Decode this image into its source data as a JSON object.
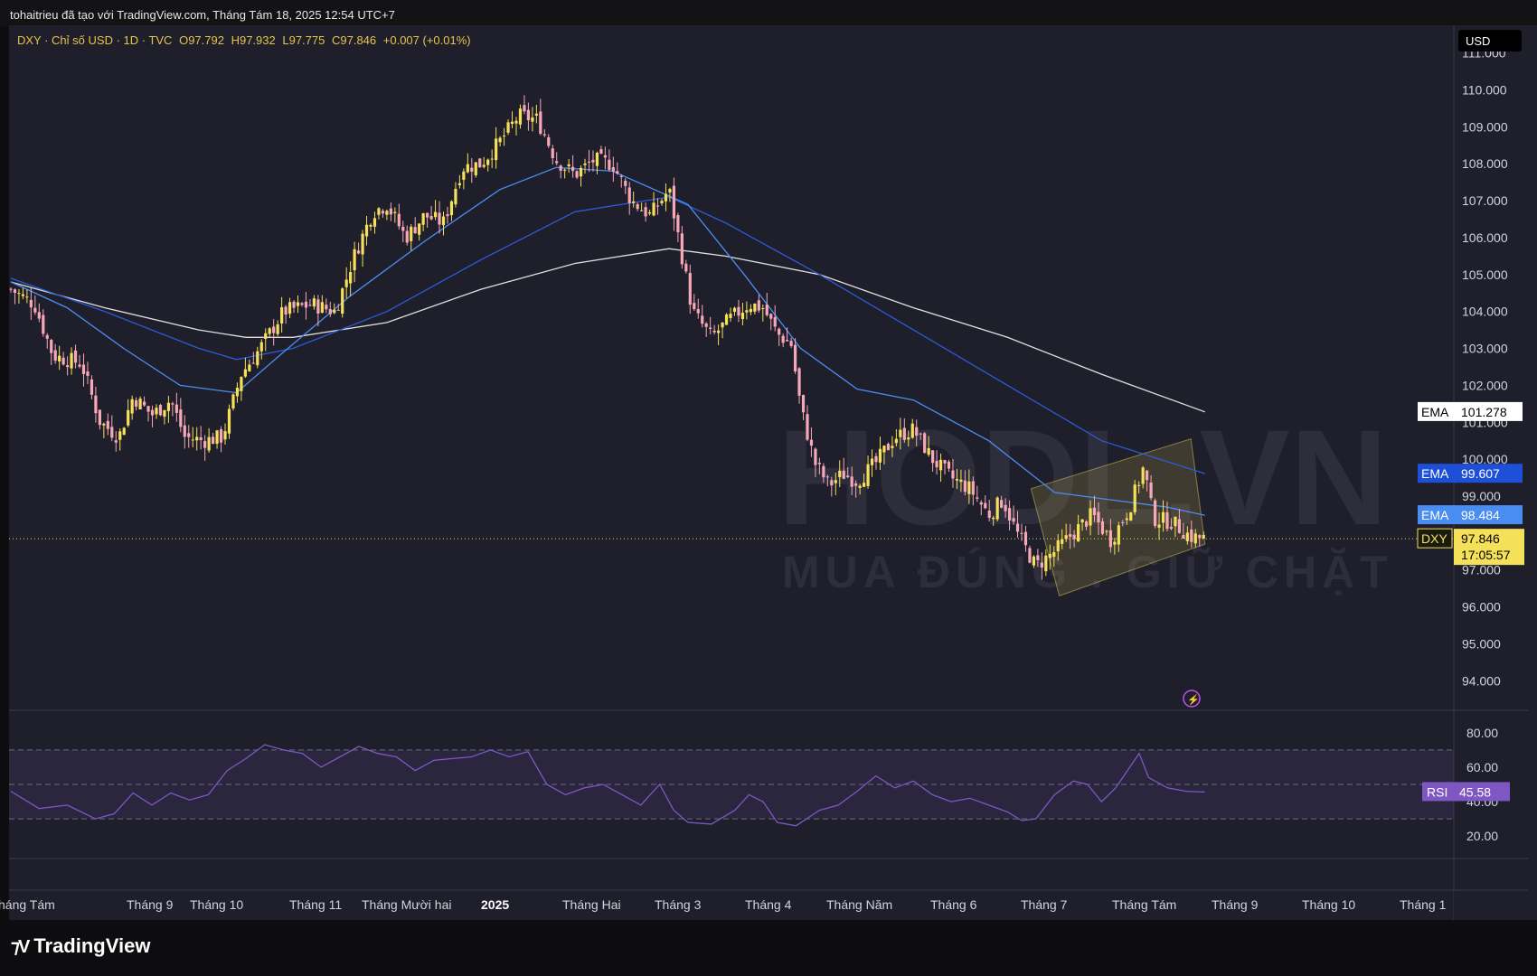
{
  "header": {
    "attribution": "tohaitrieu đã tạo với TradingView.com, Tháng Tám 18, 2025 12:54 UTC+7"
  },
  "symbol_line": {
    "name": "DXY · Chỉ số USD · 1D · TVC",
    "open": "O97.792",
    "high": "H97.932",
    "low": "L97.775",
    "close": "C97.846",
    "change": "+0.007 (+0.01%)"
  },
  "currency_label": "USD",
  "watermark": {
    "brand": "HODL.VN",
    "tagline": "MUA ĐÚNG . GIỮ CHẶT"
  },
  "price_labels": [
    {
      "name": "EMA",
      "value": "101.278",
      "color": "#ffffff"
    },
    {
      "name": "EMA",
      "value": "99.607",
      "color": "#1e4fd8"
    },
    {
      "name": "EMA",
      "value": "98.484",
      "color": "#4a8df0"
    },
    {
      "name": "DXY",
      "value": "97.846",
      "countdown": "17:05:57",
      "color": "#f5e05a"
    }
  ],
  "rsi_label": {
    "name": "RSI",
    "value": "45.58",
    "color": "#7e57c2"
  },
  "footer": {
    "brand": "TradingView"
  },
  "colors": {
    "background": "#1f1f2b",
    "up": "#f5e05a",
    "down": "#f7a8b8",
    "ema_white": "#e0e0e0",
    "ema_dark_blue": "#2b5bd8",
    "ema_light_blue": "#4a8df0",
    "rsi": "#7e57c2"
  },
  "chart_data": [
    {
      "type": "candlestick",
      "symbol": "DXY",
      "timeframe": "1D",
      "y_axis": {
        "ticks": [
          "111.000",
          "110.000",
          "109.000",
          "108.000",
          "107.000",
          "106.000",
          "105.000",
          "104.000",
          "103.000",
          "102.000",
          "101.000",
          "100.000",
          "99.000",
          "97.000",
          "96.000",
          "95.000",
          "94.000"
        ],
        "range": [
          93.2,
          111.7
        ]
      },
      "x_axis": {
        "ticks": [
          "háng Tám",
          "Tháng 9",
          "Tháng 10",
          "Tháng 11",
          "Tháng Mười hai",
          "2025",
          "Tháng Hai",
          "Tháng 3",
          "Tháng 4",
          "Tháng Năm",
          "Tháng 6",
          "Tháng 7",
          "Tháng Tám",
          "Tháng 9",
          "Tháng 10",
          "Tháng 1"
        ]
      },
      "close_path": [
        {
          "x": 0,
          "y": 104.6
        },
        {
          "x": 25,
          "y": 104.2
        },
        {
          "x": 45,
          "y": 102.8
        },
        {
          "x": 75,
          "y": 102.6
        },
        {
          "x": 95,
          "y": 101.0
        },
        {
          "x": 115,
          "y": 100.6
        },
        {
          "x": 130,
          "y": 101.7
        },
        {
          "x": 150,
          "y": 101.2
        },
        {
          "x": 170,
          "y": 101.6
        },
        {
          "x": 185,
          "y": 100.6
        },
        {
          "x": 205,
          "y": 100.5
        },
        {
          "x": 225,
          "y": 100.6
        },
        {
          "x": 245,
          "y": 102.3
        },
        {
          "x": 265,
          "y": 103.0
        },
        {
          "x": 290,
          "y": 104.0
        },
        {
          "x": 320,
          "y": 104.2
        },
        {
          "x": 345,
          "y": 104.0
        },
        {
          "x": 365,
          "y": 105.5
        },
        {
          "x": 385,
          "y": 106.7
        },
        {
          "x": 400,
          "y": 106.9
        },
        {
          "x": 420,
          "y": 106.0
        },
        {
          "x": 440,
          "y": 106.6
        },
        {
          "x": 460,
          "y": 106.4
        },
        {
          "x": 480,
          "y": 107.9
        },
        {
          "x": 500,
          "y": 108.0
        },
        {
          "x": 520,
          "y": 108.6
        },
        {
          "x": 540,
          "y": 109.3
        },
        {
          "x": 560,
          "y": 109.2
        },
        {
          "x": 580,
          "y": 108.1
        },
        {
          "x": 600,
          "y": 107.7
        },
        {
          "x": 620,
          "y": 108.1
        },
        {
          "x": 640,
          "y": 108.0
        },
        {
          "x": 660,
          "y": 107.0
        },
        {
          "x": 680,
          "y": 106.6
        },
        {
          "x": 700,
          "y": 107.3
        },
        {
          "x": 710,
          "y": 106.0
        },
        {
          "x": 725,
          "y": 104.0
        },
        {
          "x": 745,
          "y": 103.3
        },
        {
          "x": 765,
          "y": 103.8
        },
        {
          "x": 785,
          "y": 104.2
        },
        {
          "x": 800,
          "y": 104.1
        },
        {
          "x": 815,
          "y": 103.4
        },
        {
          "x": 830,
          "y": 103.1
        },
        {
          "x": 840,
          "y": 101.4
        },
        {
          "x": 855,
          "y": 99.9
        },
        {
          "x": 870,
          "y": 99.3
        },
        {
          "x": 885,
          "y": 99.6
        },
        {
          "x": 900,
          "y": 99.4
        },
        {
          "x": 920,
          "y": 99.9
        },
        {
          "x": 940,
          "y": 100.6
        },
        {
          "x": 960,
          "y": 100.8
        },
        {
          "x": 980,
          "y": 100.0
        },
        {
          "x": 1000,
          "y": 99.5
        },
        {
          "x": 1020,
          "y": 99.2
        },
        {
          "x": 1040,
          "y": 98.5
        },
        {
          "x": 1055,
          "y": 98.9
        },
        {
          "x": 1070,
          "y": 98.0
        },
        {
          "x": 1090,
          "y": 97.1
        },
        {
          "x": 1110,
          "y": 97.5
        },
        {
          "x": 1130,
          "y": 98.0
        },
        {
          "x": 1150,
          "y": 98.5
        },
        {
          "x": 1170,
          "y": 97.8
        },
        {
          "x": 1190,
          "y": 98.7
        },
        {
          "x": 1205,
          "y": 99.8
        },
        {
          "x": 1215,
          "y": 98.4
        },
        {
          "x": 1235,
          "y": 98.3
        },
        {
          "x": 1255,
          "y": 97.9
        },
        {
          "x": 1270,
          "y": 97.85
        }
      ],
      "series": [
        {
          "name": "EMA",
          "last": 101.278,
          "values": [
            {
              "x": 0,
              "y": 104.8
            },
            {
              "x": 100,
              "y": 104.1
            },
            {
              "x": 200,
              "y": 103.5
            },
            {
              "x": 250,
              "y": 103.3
            },
            {
              "x": 300,
              "y": 103.3
            },
            {
              "x": 400,
              "y": 103.7
            },
            {
              "x": 500,
              "y": 104.6
            },
            {
              "x": 600,
              "y": 105.3
            },
            {
              "x": 700,
              "y": 105.7
            },
            {
              "x": 760,
              "y": 105.5
            },
            {
              "x": 860,
              "y": 105.0
            },
            {
              "x": 960,
              "y": 104.1
            },
            {
              "x": 1060,
              "y": 103.3
            },
            {
              "x": 1160,
              "y": 102.3
            },
            {
              "x": 1270,
              "y": 101.28
            }
          ]
        },
        {
          "name": "EMA",
          "last": 99.607,
          "values": [
            {
              "x": 0,
              "y": 104.9
            },
            {
              "x": 100,
              "y": 104.0
            },
            {
              "x": 200,
              "y": 103.0
            },
            {
              "x": 240,
              "y": 102.7
            },
            {
              "x": 300,
              "y": 103.0
            },
            {
              "x": 400,
              "y": 104.0
            },
            {
              "x": 500,
              "y": 105.4
            },
            {
              "x": 600,
              "y": 106.7
            },
            {
              "x": 700,
              "y": 107.1
            },
            {
              "x": 760,
              "y": 106.4
            },
            {
              "x": 860,
              "y": 105.0
            },
            {
              "x": 960,
              "y": 103.5
            },
            {
              "x": 1060,
              "y": 102.0
            },
            {
              "x": 1160,
              "y": 100.5
            },
            {
              "x": 1270,
              "y": 99.61
            }
          ]
        },
        {
          "name": "EMA",
          "last": 98.484,
          "values": [
            {
              "x": 0,
              "y": 104.8
            },
            {
              "x": 60,
              "y": 104.1
            },
            {
              "x": 120,
              "y": 103.0
            },
            {
              "x": 180,
              "y": 102.0
            },
            {
              "x": 240,
              "y": 101.8
            },
            {
              "x": 290,
              "y": 102.9
            },
            {
              "x": 360,
              "y": 104.4
            },
            {
              "x": 440,
              "y": 105.9
            },
            {
              "x": 520,
              "y": 107.3
            },
            {
              "x": 580,
              "y": 107.9
            },
            {
              "x": 640,
              "y": 107.8
            },
            {
              "x": 720,
              "y": 106.9
            },
            {
              "x": 780,
              "y": 105.0
            },
            {
              "x": 840,
              "y": 103.0
            },
            {
              "x": 900,
              "y": 101.9
            },
            {
              "x": 960,
              "y": 101.6
            },
            {
              "x": 1040,
              "y": 100.5
            },
            {
              "x": 1110,
              "y": 99.1
            },
            {
              "x": 1170,
              "y": 98.9
            },
            {
              "x": 1230,
              "y": 98.7
            },
            {
              "x": 1270,
              "y": 98.48
            }
          ]
        }
      ],
      "last_price": 97.846,
      "annotation": {
        "type": "channel",
        "shaded": true
      }
    },
    {
      "type": "line",
      "name": "RSI",
      "y_axis": {
        "ticks": [
          "80.00",
          "60.00",
          "40.00",
          "20.00"
        ],
        "range": [
          7,
          93
        ]
      },
      "bands": [
        70,
        50,
        30
      ],
      "last": 45.58,
      "values": [
        {
          "x": 0,
          "y": 46
        },
        {
          "x": 30,
          "y": 36
        },
        {
          "x": 60,
          "y": 38
        },
        {
          "x": 90,
          "y": 30
        },
        {
          "x": 110,
          "y": 33
        },
        {
          "x": 130,
          "y": 45
        },
        {
          "x": 150,
          "y": 38
        },
        {
          "x": 170,
          "y": 45
        },
        {
          "x": 190,
          "y": 41
        },
        {
          "x": 210,
          "y": 44
        },
        {
          "x": 230,
          "y": 58
        },
        {
          "x": 250,
          "y": 65
        },
        {
          "x": 270,
          "y": 73
        },
        {
          "x": 290,
          "y": 70
        },
        {
          "x": 310,
          "y": 68
        },
        {
          "x": 330,
          "y": 60
        },
        {
          "x": 350,
          "y": 66
        },
        {
          "x": 370,
          "y": 72
        },
        {
          "x": 390,
          "y": 68
        },
        {
          "x": 410,
          "y": 66
        },
        {
          "x": 430,
          "y": 58
        },
        {
          "x": 450,
          "y": 64
        },
        {
          "x": 470,
          "y": 65
        },
        {
          "x": 490,
          "y": 66
        },
        {
          "x": 510,
          "y": 70
        },
        {
          "x": 530,
          "y": 66
        },
        {
          "x": 550,
          "y": 69
        },
        {
          "x": 570,
          "y": 50
        },
        {
          "x": 590,
          "y": 44
        },
        {
          "x": 610,
          "y": 48
        },
        {
          "x": 630,
          "y": 50
        },
        {
          "x": 650,
          "y": 44
        },
        {
          "x": 670,
          "y": 38
        },
        {
          "x": 690,
          "y": 50
        },
        {
          "x": 705,
          "y": 35
        },
        {
          "x": 720,
          "y": 28
        },
        {
          "x": 745,
          "y": 27
        },
        {
          "x": 770,
          "y": 35
        },
        {
          "x": 785,
          "y": 44
        },
        {
          "x": 800,
          "y": 40
        },
        {
          "x": 815,
          "y": 28
        },
        {
          "x": 835,
          "y": 26
        },
        {
          "x": 860,
          "y": 35
        },
        {
          "x": 880,
          "y": 38
        },
        {
          "x": 900,
          "y": 46
        },
        {
          "x": 920,
          "y": 55
        },
        {
          "x": 940,
          "y": 48
        },
        {
          "x": 960,
          "y": 52
        },
        {
          "x": 980,
          "y": 44
        },
        {
          "x": 1000,
          "y": 40
        },
        {
          "x": 1020,
          "y": 42
        },
        {
          "x": 1040,
          "y": 38
        },
        {
          "x": 1060,
          "y": 34
        },
        {
          "x": 1075,
          "y": 29
        },
        {
          "x": 1090,
          "y": 30
        },
        {
          "x": 1110,
          "y": 44
        },
        {
          "x": 1130,
          "y": 52
        },
        {
          "x": 1145,
          "y": 50
        },
        {
          "x": 1160,
          "y": 40
        },
        {
          "x": 1175,
          "y": 48
        },
        {
          "x": 1190,
          "y": 60
        },
        {
          "x": 1200,
          "y": 68
        },
        {
          "x": 1210,
          "y": 54
        },
        {
          "x": 1230,
          "y": 48
        },
        {
          "x": 1250,
          "y": 46
        },
        {
          "x": 1270,
          "y": 45.58
        }
      ]
    }
  ]
}
